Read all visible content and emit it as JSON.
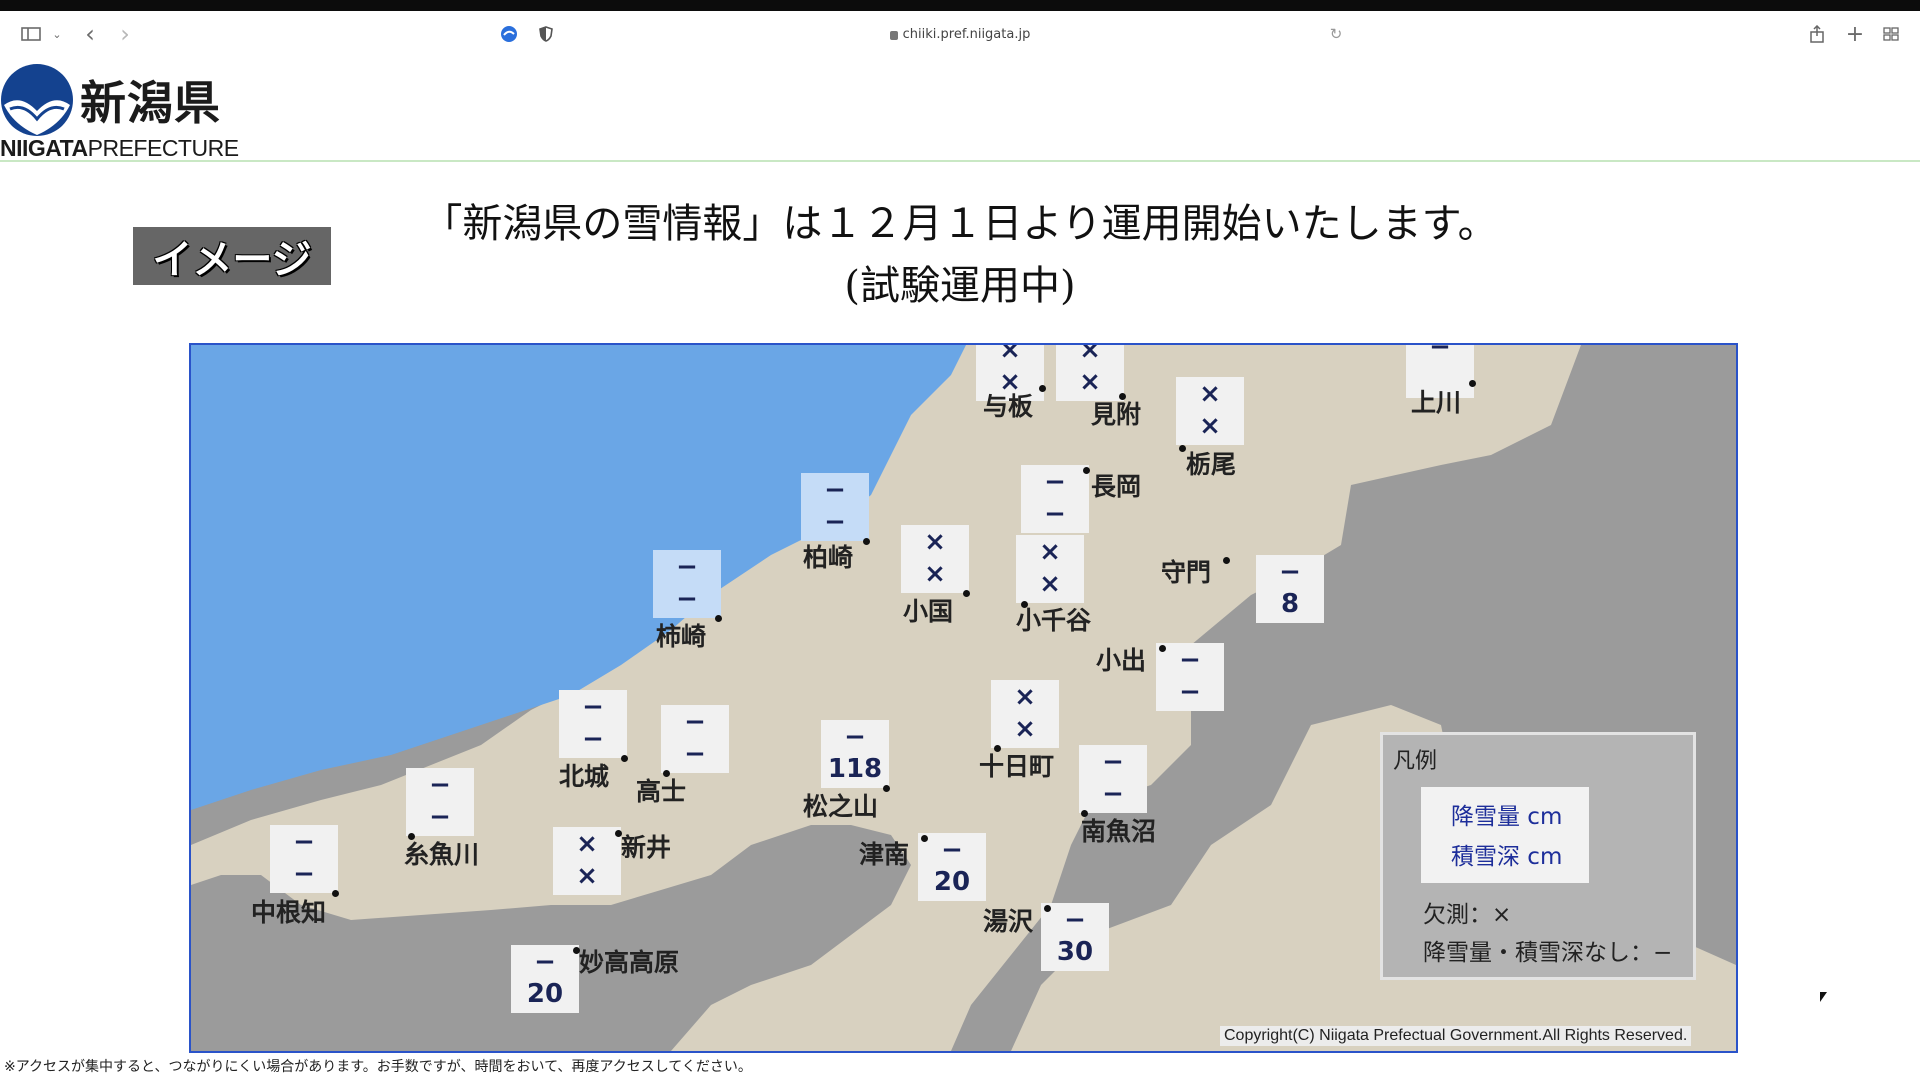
{
  "browser": {
    "url": "chiiki.pref.niigata.jp",
    "icons": [
      "sidebar-icon",
      "chevron-down-icon",
      "back-icon",
      "forward-icon",
      "edge-icon",
      "shield-icon",
      "reload-icon",
      "share-icon",
      "plus-icon",
      "tabs-grid-icon"
    ]
  },
  "header": {
    "logo_ja": "新潟県",
    "logo_en_bold": "NIIGATA",
    "logo_en_rest": "PREFECTURE"
  },
  "badge": "イメージ",
  "announcement": {
    "line1": "「新潟県の雪情報」は１２月１日より運用開始いたします。",
    "line2": "(試験運用中)"
  },
  "colors": {
    "sea": "#6aa6e6",
    "land": "#d8d1c0",
    "other_land": "#9b9b9b",
    "value_text": "#1a2456",
    "box_coastal": "#c5dcf7",
    "frame": "#2a53c9"
  },
  "stations": [
    {
      "name": "与板",
      "snowfall": "×",
      "depth": "×"
    },
    {
      "name": "見附",
      "snowfall": "×",
      "depth": "×"
    },
    {
      "name": "栃尾",
      "snowfall": "×",
      "depth": "×"
    },
    {
      "name": "上川",
      "snowfall": "−",
      "depth": ""
    },
    {
      "name": "長岡",
      "snowfall": "−",
      "depth": "−"
    },
    {
      "name": "柏崎",
      "snowfall": "−",
      "depth": "−"
    },
    {
      "name": "小国",
      "snowfall": "×",
      "depth": "×"
    },
    {
      "name": "小千谷",
      "snowfall": "×",
      "depth": "×"
    },
    {
      "name": "守門",
      "snowfall": "−",
      "depth": "8"
    },
    {
      "name": "柿崎",
      "snowfall": "−",
      "depth": "−"
    },
    {
      "name": "小出",
      "snowfall": "−",
      "depth": "−"
    },
    {
      "name": "北城",
      "snowfall": "−",
      "depth": "−"
    },
    {
      "name": "高士",
      "snowfall": "−",
      "depth": "−"
    },
    {
      "name": "松之山",
      "snowfall": "−",
      "depth": "118"
    },
    {
      "name": "十日町",
      "snowfall": "×",
      "depth": "×"
    },
    {
      "name": "南魚沼",
      "snowfall": "−",
      "depth": "−"
    },
    {
      "name": "糸魚川",
      "snowfall": "−",
      "depth": "−"
    },
    {
      "name": "新井",
      "snowfall": "×",
      "depth": "×"
    },
    {
      "name": "津南",
      "snowfall": "−",
      "depth": "20"
    },
    {
      "name": "中根知",
      "snowfall": "−",
      "depth": "−"
    },
    {
      "name": "湯沢",
      "snowfall": "−",
      "depth": "30"
    },
    {
      "name": "妙高高原",
      "snowfall": "−",
      "depth": "20"
    }
  ],
  "legend": {
    "title": "凡例",
    "snowfall": "降雪量 cm",
    "depth": "積雪深 cm",
    "missing": "欠測：×",
    "none": "降雪量・積雪深なし：−"
  },
  "copyright": "Copyright(C) Niigata Prefectual Government.All Rights Reserved.",
  "footnote": "※アクセスが集中すると、つながりにくい場合があります。お手数ですが、時間をおいて、再度アクセスしてください。"
}
